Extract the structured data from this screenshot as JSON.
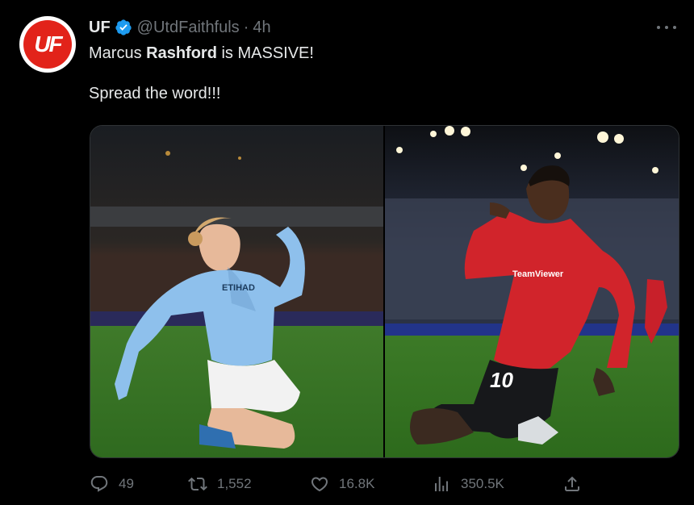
{
  "author": {
    "avatar_text": "UF",
    "name": "UF",
    "handle": "@UtdFaithfuls",
    "separator": "·",
    "time": "4h"
  },
  "tweet": {
    "line1_pre": "Marcus ",
    "line1_bold": "Rashford",
    "line1_post": " is MASSIVE!",
    "line2": "Spread the word!!!"
  },
  "media": {
    "left_photo": {
      "sponsor_text": "ETIHAD"
    },
    "right_photo": {
      "sponsor_text": "TeamViewer",
      "shirt_number": "10"
    }
  },
  "actions": {
    "replies": "49",
    "reposts": "1,552",
    "likes": "16.8K",
    "views": "350.5K"
  },
  "colors": {
    "background": "#000000",
    "text": "#e7e9ea",
    "muted": "#71767b",
    "verified": "#1d9bf0",
    "brand_red": "#e2231a"
  }
}
